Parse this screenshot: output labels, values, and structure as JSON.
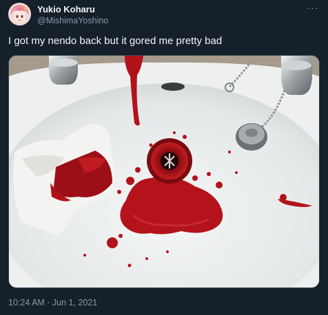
{
  "tweet": {
    "display_name": "Yukio Koharu",
    "handle": "@MishimaYoshino",
    "text": "I got my nendo back but it gored me pretty bad",
    "timestamp": "10:24 AM · Jun 1, 2021",
    "more_icon": "more-horizontal-icon",
    "more_glyph": "···"
  },
  "colors": {
    "background": "#15202b",
    "primary_text": "#f7f9f9",
    "secondary_text": "#8b98a5",
    "border": "#38444d",
    "blood": "#b3121b"
  }
}
